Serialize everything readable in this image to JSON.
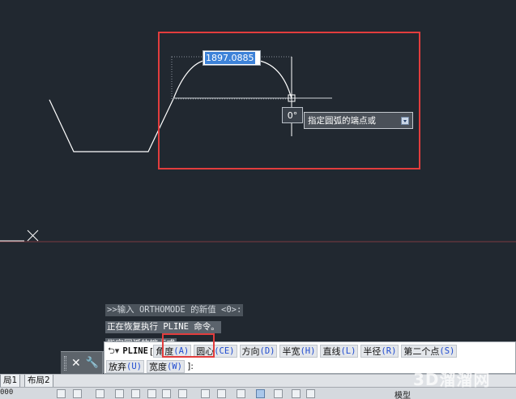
{
  "canvas": {
    "background": "#212830",
    "geometry_color": "#ffffff",
    "axis_line_color": "#7a3a40",
    "crosshair_color": "#ffffff"
  },
  "dynamic_input": {
    "value": "1897.0885",
    "angle": "0°",
    "tooltip": "指定圆弧的端点或",
    "tooltip_dropdown_icon": "chevron-down-icon"
  },
  "command_history": [
    ">>输入 ORTHOMODE 的新值 <0>:",
    "正在恢复执行 PLINE 命令。",
    "指定圆弧的端点或"
  ],
  "command_line": {
    "prompt_icon": "command-prompt-icon",
    "command": "PLINE",
    "open_bracket": "[",
    "options": [
      {
        "label": "角度",
        "key": "(A)"
      },
      {
        "label": "圆心",
        "key": "(CE)"
      },
      {
        "label": "方向",
        "key": "(D)"
      },
      {
        "label": "半宽",
        "key": "(H)"
      },
      {
        "label": "直线",
        "key": "(L)"
      },
      {
        "label": "半径",
        "key": "(R)"
      },
      {
        "label": "第二个点",
        "key": "(S)"
      },
      {
        "label": "放弃",
        "key": "(U)"
      },
      {
        "label": "宽度",
        "key": "(W)"
      }
    ],
    "close_bracket": "]:"
  },
  "command_controls": {
    "close_icon": "close-icon",
    "close_label": "✕",
    "customize_icon": "wrench-icon",
    "customize_label": "🔧"
  },
  "layout_tabs": [
    "局1",
    "布局2"
  ],
  "status_bar": {
    "coordinates": "000",
    "model_label": "模型"
  },
  "watermark": "3D溜溜网",
  "highlight_color": "#e23d3d"
}
